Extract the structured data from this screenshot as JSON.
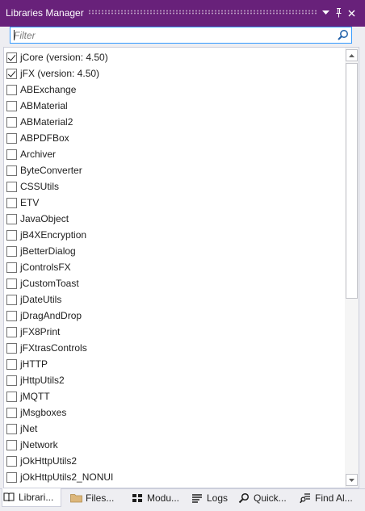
{
  "window": {
    "title": "Libraries Manager",
    "buttons": {
      "dropdown_icon": "chevron-down-icon",
      "pin_icon": "pin-icon",
      "close_icon": "close-icon"
    }
  },
  "filter": {
    "placeholder": "Filter",
    "value": "",
    "icon": "search-icon"
  },
  "libraries": [
    {
      "label": "jCore (version: 4.50)",
      "checked": true
    },
    {
      "label": "jFX (version: 4.50)",
      "checked": true
    },
    {
      "label": "ABExchange",
      "checked": false
    },
    {
      "label": "ABMaterial",
      "checked": false
    },
    {
      "label": "ABMaterial2",
      "checked": false
    },
    {
      "label": "ABPDFBox",
      "checked": false
    },
    {
      "label": "Archiver",
      "checked": false
    },
    {
      "label": "ByteConverter",
      "checked": false
    },
    {
      "label": "CSSUtils",
      "checked": false
    },
    {
      "label": "ETV",
      "checked": false
    },
    {
      "label": "JavaObject",
      "checked": false
    },
    {
      "label": "jB4XEncryption",
      "checked": false
    },
    {
      "label": "jBetterDialog",
      "checked": false
    },
    {
      "label": "jControlsFX",
      "checked": false
    },
    {
      "label": "jCustomToast",
      "checked": false
    },
    {
      "label": "jDateUtils",
      "checked": false
    },
    {
      "label": "jDragAndDrop",
      "checked": false
    },
    {
      "label": "jFX8Print",
      "checked": false
    },
    {
      "label": "jFXtrasControls",
      "checked": false
    },
    {
      "label": "jHTTP",
      "checked": false
    },
    {
      "label": "jHttpUtils2",
      "checked": false
    },
    {
      "label": "jMQTT",
      "checked": false
    },
    {
      "label": "jMsgboxes",
      "checked": false
    },
    {
      "label": "jNet",
      "checked": false
    },
    {
      "label": "jNetwork",
      "checked": false
    },
    {
      "label": "jOkHttpUtils2",
      "checked": false
    },
    {
      "label": "jOkHttpUtils2_NONUI",
      "checked": false
    }
  ],
  "tabs": [
    {
      "label": "Librari...",
      "icon": "book-icon",
      "active": true
    },
    {
      "label": "Files...",
      "icon": "folder-icon",
      "active": false
    },
    {
      "label": "Modu...",
      "icon": "modules-icon",
      "active": false
    },
    {
      "label": "Logs",
      "icon": "list-icon",
      "active": false
    },
    {
      "label": "Quick...",
      "icon": "search-icon",
      "active": false
    },
    {
      "label": "Find Al...",
      "icon": "find-all-icon",
      "active": false
    }
  ],
  "colors": {
    "titlebar": "#68217a",
    "accent_border": "#3399ff",
    "panel_background": "#eeeef2"
  }
}
